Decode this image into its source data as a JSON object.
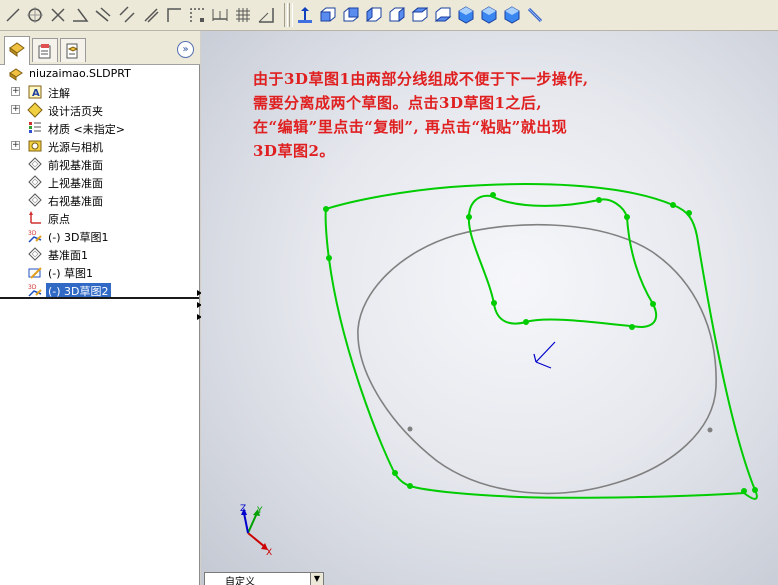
{
  "toolbar": {
    "left_buttons": [
      "line-icon",
      "circle-icon",
      "trim-icon",
      "angle-icon",
      "construction-icon",
      "parallel-icon",
      "perpendicular-icon",
      "corner-icon",
      "pattern-icon",
      "dimension-icon",
      "grid-icon",
      "measure-icon"
    ],
    "right_buttons": [
      "normal-to-icon",
      "front-view-icon",
      "back-view-icon",
      "left-view-icon",
      "right-view-icon",
      "top-view-icon",
      "bottom-view-icon",
      "isometric-icon",
      "trimetric-icon",
      "dimetric-icon",
      "hide-show-icon"
    ]
  },
  "panel": {
    "tabs": [
      "feature-manager-tab",
      "property-manager-tab",
      "configuration-manager-tab"
    ],
    "expand_symbol": "»",
    "tree": [
      {
        "label": "niuzaimao.SLDPRT",
        "icon": "part-icon",
        "expand": false,
        "indent": 0
      },
      {
        "label": "注解",
        "icon": "annotation-icon",
        "expand": true,
        "indent": 1
      },
      {
        "label": "设计活页夹",
        "icon": "design-binder-icon",
        "expand": true,
        "indent": 1
      },
      {
        "label": "材质 <未指定>",
        "icon": "material-icon",
        "expand": false,
        "indent": 1
      },
      {
        "label": "光源与相机",
        "icon": "lights-camera-icon",
        "expand": true,
        "indent": 1
      },
      {
        "label": "前视基准面",
        "icon": "plane-icon",
        "expand": false,
        "indent": 1
      },
      {
        "label": "上视基准面",
        "icon": "plane-icon",
        "expand": false,
        "indent": 1
      },
      {
        "label": "右视基准面",
        "icon": "plane-icon",
        "expand": false,
        "indent": 1
      },
      {
        "label": "原点",
        "icon": "origin-icon",
        "expand": false,
        "indent": 1
      },
      {
        "label": "(-) 3D草图1",
        "icon": "3d-sketch-icon",
        "expand": false,
        "indent": 1
      },
      {
        "label": "基准面1",
        "icon": "plane-icon",
        "expand": false,
        "indent": 1
      },
      {
        "label": "(-) 草图1",
        "icon": "sketch-icon",
        "expand": false,
        "indent": 1
      },
      {
        "label": "(-) 3D草图2",
        "icon": "3d-sketch-icon",
        "expand": false,
        "indent": 1,
        "selected": true
      }
    ]
  },
  "annotation": {
    "lines": [
      "由于3D草图1由两部分线组成不便于下一步操作,",
      "需要分离成两个草图。点击3D草图1之后,",
      "在“编辑”里点击“复制”, 再点击“粘贴”就出现",
      "3D草图2。"
    ],
    "color": "#e02020"
  },
  "viewport": {
    "view_dropdown": "自定义",
    "triad_labels": {
      "x": "X",
      "y": "Y",
      "z": "Z"
    }
  },
  "colors": {
    "sketch_green": "#00cc00",
    "sketch_gray": "#808080",
    "selection_blue": "#316ac5"
  }
}
